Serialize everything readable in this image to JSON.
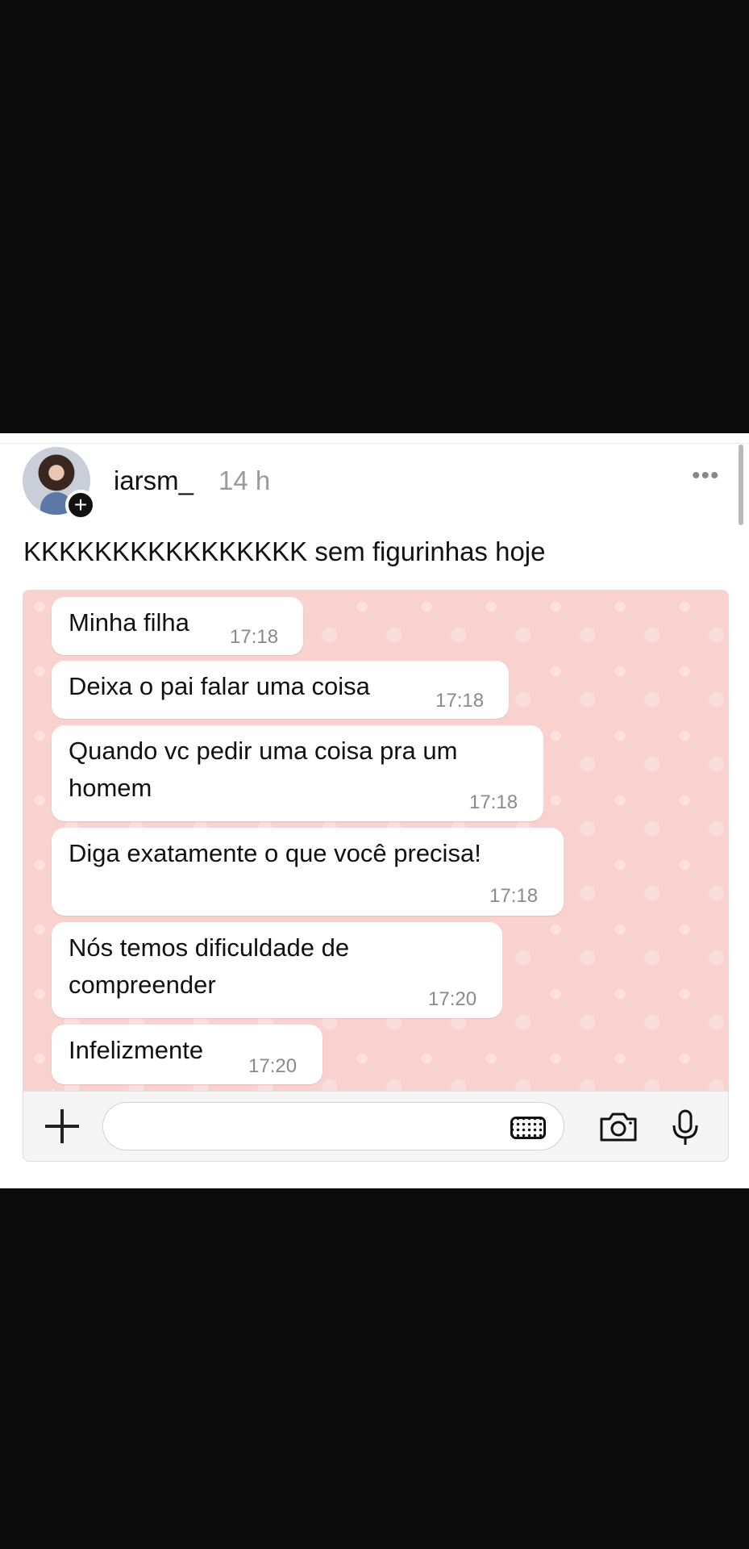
{
  "post": {
    "username": "iarsm_",
    "time": "14 h",
    "more": "•••",
    "caption": "KKKKKKKKKKKKKKKK sem figurinhas hoje"
  },
  "chat": {
    "messages": [
      {
        "line1": "Minha filha",
        "line2": "",
        "time": "17:18"
      },
      {
        "line1": "Deixa o pai falar uma coisa",
        "line2": "",
        "time": "17:18"
      },
      {
        "line1": "Quando vc pedir uma coisa pra um",
        "line2": "homem",
        "time": "17:18"
      },
      {
        "line1": "Diga exatamente o que você precisa!",
        "line2": "",
        "time": "17:18"
      },
      {
        "line1": "Nós temos dificuldade de",
        "line2": "compreender",
        "time": "17:20"
      },
      {
        "line1": "Infelizmente",
        "line2": "",
        "time": "17:20"
      }
    ],
    "input": {
      "icons": [
        "plus-icon",
        "keyboard-icon",
        "camera-icon",
        "microphone-icon"
      ]
    }
  }
}
